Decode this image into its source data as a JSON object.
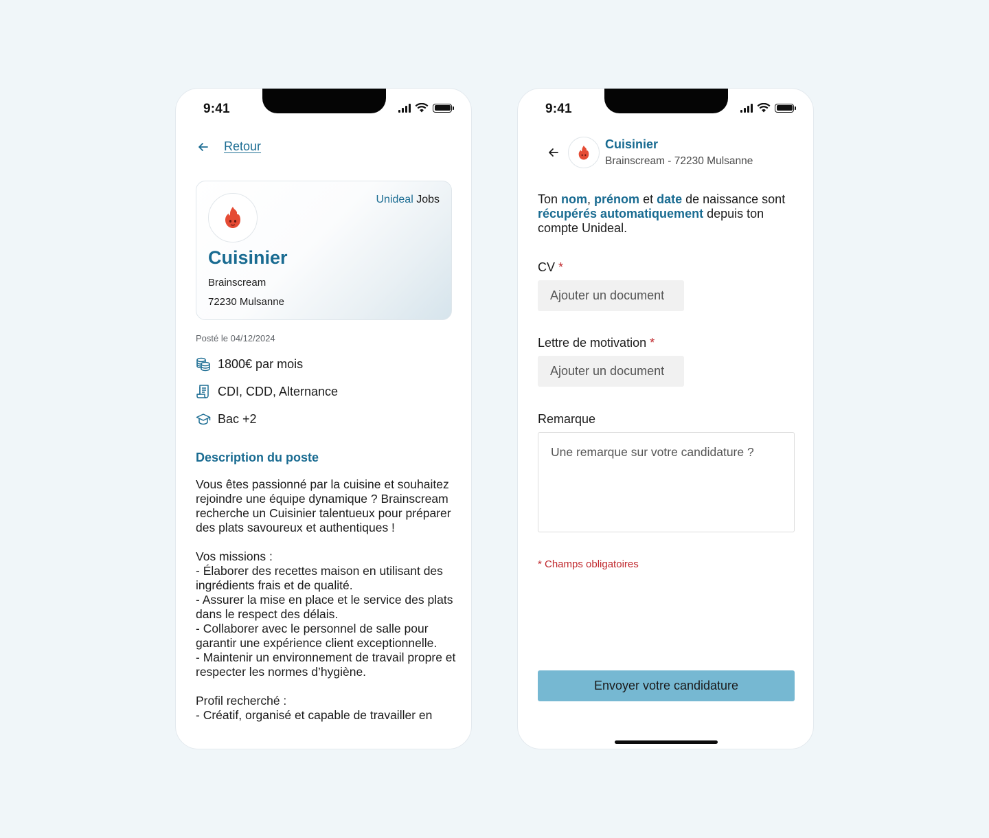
{
  "status_bar": {
    "time": "9:41"
  },
  "detail_screen": {
    "back_label": "Retour",
    "card": {
      "brand_part1": "Unideal",
      "brand_part2": "Jobs",
      "title": "Cuisinier",
      "company": "Brainscream",
      "location": "72230 Mulsanne"
    },
    "posted": "Posté le 04/12/2024",
    "info": [
      {
        "icon": "coins-icon",
        "text": "1800€ par mois"
      },
      {
        "icon": "contract-icon",
        "text": "CDI, CDD, Alternance"
      },
      {
        "icon": "graduation-cap-icon",
        "text": "Bac +2"
      }
    ],
    "description_title": "Description du poste",
    "description_text": "Vous êtes passionné par la cuisine et souhaitez rejoindre une équipe dynamique ? Brainscream recherche un Cuisinier talentueux pour préparer des plats savoureux et authentiques !\n\nVos missions :\n- Élaborer des recettes maison en utilisant des ingrédients frais et de qualité.\n- Assurer la mise en place et le service des plats dans le respect des délais.\n- Collaborer avec le personnel de salle pour garantir une expérience client exceptionnelle.\n- Maintenir un environnement de travail propre et respecter les normes d’hygiène.\n\nProfil recherché :\n- Créatif, organisé et capable de travailler en"
  },
  "apply_screen": {
    "header": {
      "title": "Cuisinier",
      "subtitle": "Brainscream - 72230 Mulsanne"
    },
    "intro": {
      "t1": "Ton ",
      "h1": "nom",
      "t2": ", ",
      "h2": "prénom",
      "t3": " et ",
      "h3": "date",
      "t4": " de naissance sont ",
      "h4": "récupérés automatiquement",
      "t5": " depuis ton compte Unideal."
    },
    "cv_label": "CV",
    "required_mark": "*",
    "cv_button": "Ajouter un document",
    "letter_label": "Lettre de motivation",
    "letter_button": "Ajouter un document",
    "remark_label": "Remarque",
    "remark_placeholder": "Une remarque sur votre candidature ?",
    "required_note": "* Champs obligatoires",
    "submit_label": "Envoyer votre candidature"
  },
  "colors": {
    "accent": "#196b91",
    "required": "#c0282d",
    "submit_bg": "#76b8d2",
    "logo_flame": "#e54b34"
  }
}
